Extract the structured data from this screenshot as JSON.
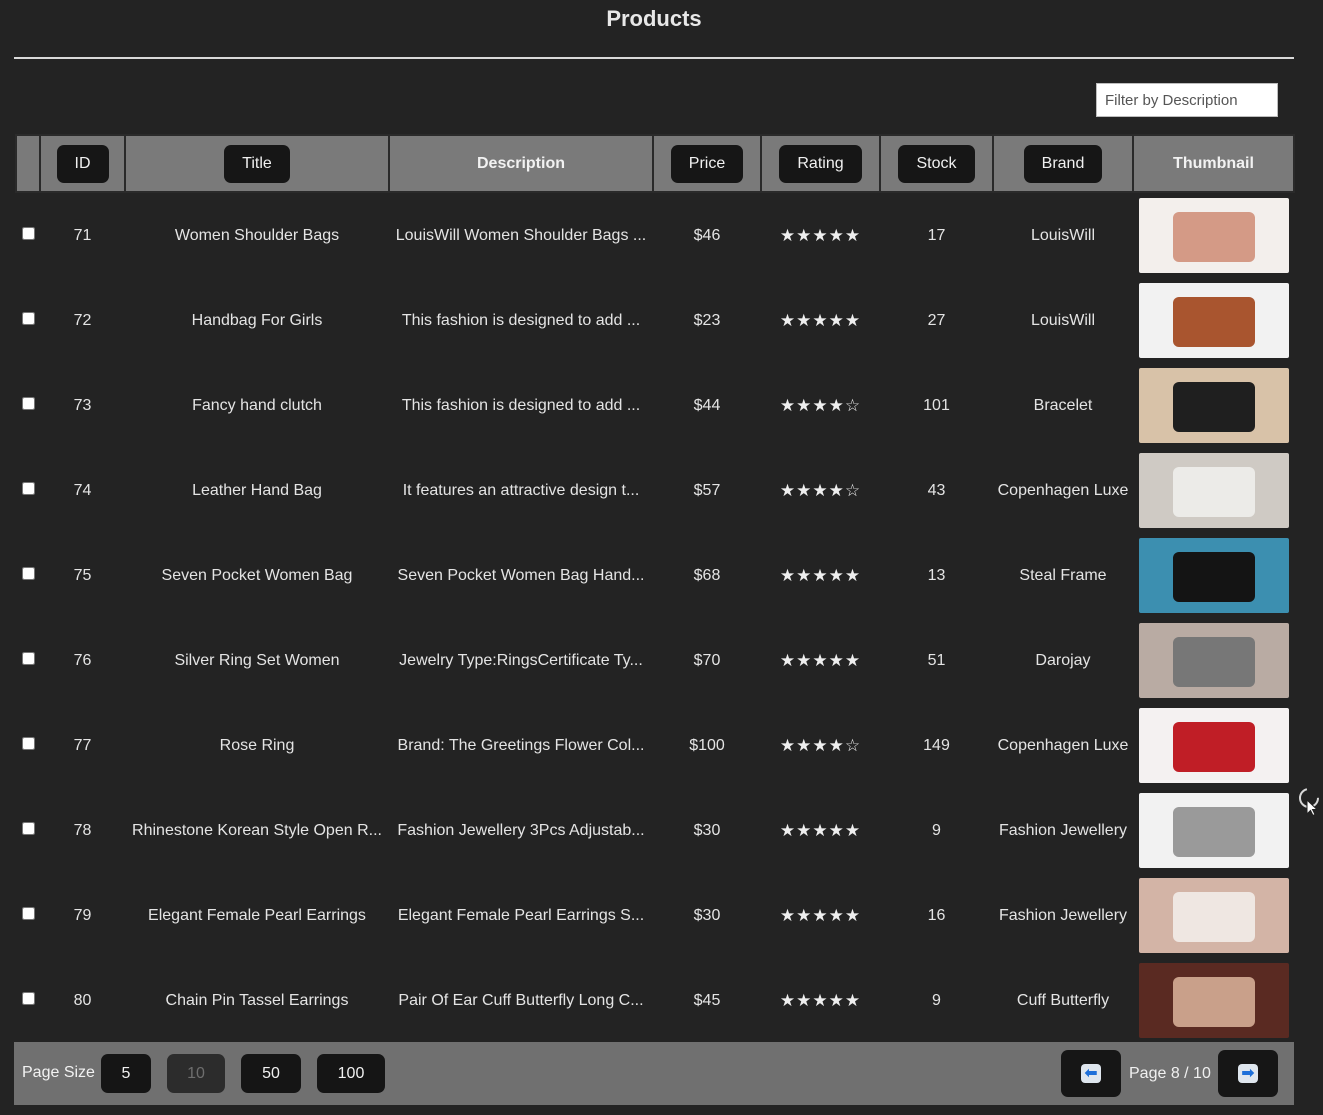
{
  "page": {
    "title": "Products"
  },
  "filter": {
    "placeholder": "Filter by Description",
    "value": ""
  },
  "table": {
    "columns": {
      "id": "ID",
      "title": "Title",
      "description": "Description",
      "price": "Price",
      "rating": "Rating",
      "stock": "Stock",
      "brand": "Brand",
      "thumbnail": "Thumbnail"
    },
    "rows": [
      {
        "id": "71",
        "title": "Women Shoulder Bags",
        "description": "LouisWill Women Shoulder Bags ...",
        "price": "$46",
        "rating": "★★★★★",
        "stock": "17",
        "brand": "LouisWill",
        "thumb": {
          "bg": "#f3efec",
          "obj": "#d49a86"
        }
      },
      {
        "id": "72",
        "title": "Handbag For Girls",
        "description": "This fashion is designed to add ...",
        "price": "$23",
        "rating": "★★★★★",
        "stock": "27",
        "brand": "LouisWill",
        "thumb": {
          "bg": "#f2f2f2",
          "obj": "#a9552f"
        }
      },
      {
        "id": "73",
        "title": "Fancy hand clutch",
        "description": "This fashion is designed to add ...",
        "price": "$44",
        "rating": "★★★★☆",
        "stock": "101",
        "brand": "Bracelet",
        "thumb": {
          "bg": "#d8c2a8",
          "obj": "#1f1f1f"
        }
      },
      {
        "id": "74",
        "title": "Leather Hand Bag",
        "description": "It features an attractive design t...",
        "price": "$57",
        "rating": "★★★★☆",
        "stock": "43",
        "brand": "Copenhagen Luxe",
        "thumb": {
          "bg": "#cfcac4",
          "obj": "#ecebe8"
        }
      },
      {
        "id": "75",
        "title": "Seven Pocket Women Bag",
        "description": "Seven Pocket Women Bag Hand...",
        "price": "$68",
        "rating": "★★★★★",
        "stock": "13",
        "brand": "Steal Frame",
        "thumb": {
          "bg": "#3c8fb0",
          "obj": "#141414"
        }
      },
      {
        "id": "76",
        "title": "Silver Ring Set Women",
        "description": "Jewelry Type:RingsCertificate Ty...",
        "price": "$70",
        "rating": "★★★★★",
        "stock": "51",
        "brand": "Darojay",
        "thumb": {
          "bg": "#b9aba3",
          "obj": "#777777"
        }
      },
      {
        "id": "77",
        "title": "Rose Ring",
        "description": "Brand: The Greetings Flower Col...",
        "price": "$100",
        "rating": "★★★★☆",
        "stock": "149",
        "brand": "Copenhagen Luxe",
        "thumb": {
          "bg": "#f4f1f1",
          "obj": "#c01e26"
        }
      },
      {
        "id": "78",
        "title": "Rhinestone Korean Style Open R...",
        "description": "Fashion Jewellery 3Pcs Adjustab...",
        "price": "$30",
        "rating": "★★★★★",
        "stock": "9",
        "brand": "Fashion Jewellery",
        "thumb": {
          "bg": "#f2f2f2",
          "obj": "#9a9a9a"
        }
      },
      {
        "id": "79",
        "title": "Elegant Female Pearl Earrings",
        "description": "Elegant Female Pearl Earrings S...",
        "price": "$30",
        "rating": "★★★★★",
        "stock": "16",
        "brand": "Fashion Jewellery",
        "thumb": {
          "bg": "#d3b4a6",
          "obj": "#efe7e2"
        }
      },
      {
        "id": "80",
        "title": "Chain Pin Tassel Earrings",
        "description": "Pair Of Ear Cuff Butterfly Long C...",
        "price": "$45",
        "rating": "★★★★★",
        "stock": "9",
        "brand": "Cuff Butterfly",
        "thumb": {
          "bg": "#5a2a22",
          "obj": "#c9a08a"
        }
      }
    ]
  },
  "footer": {
    "page_size_label": "Page Size",
    "sizes": [
      "5",
      "10",
      "50",
      "100"
    ],
    "active_size": "10",
    "page_info": "Page 8 / 10",
    "prev_icon": "left-arrow-icon",
    "next_icon": "right-arrow-icon"
  }
}
